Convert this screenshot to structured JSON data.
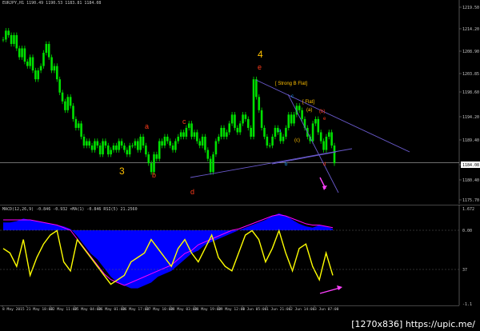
{
  "window": {
    "header": "EURJPY,H1  1190.49  1190.53  1183.81  1184.08",
    "macd_header": "MACD(12,26,9)  -0.846  -0.932   ×MA(1)  -0.846   RSI(5) 21.2560"
  },
  "watermark": "[1270x836] https://upic.me/",
  "colors": {
    "background": "#000000",
    "candle": "#00e000",
    "macd_fill": "#0000ff",
    "signal": "#ff00ff",
    "rsi": "#ffff00",
    "trendline": "#6a5acd",
    "grid": "#303030",
    "axis_text": "#c8c8c8",
    "wave_red": "#ff3b1a",
    "wave_orange": "#ffc000",
    "wave_blue": "#22a0ff"
  },
  "chart_data": [
    {
      "type": "line",
      "panel": "price",
      "yaxis_ticks": [
        "1219.50",
        "1214.20",
        "1208.90",
        "1203.85",
        "1198.60",
        "1194.20",
        "1189.40",
        "1184.08",
        "1180.40",
        "1175.70"
      ],
      "xaxis_ticks": [
        "8 May 2015",
        "21 May 18:00",
        "22 May 11:00",
        "25 May 04:00",
        "26 May 01:00",
        "26 May 17:00",
        "27 May 10:00",
        "28 May 03:00",
        "28 May 19:00",
        "29 May 12:00",
        "1 Jun 05:00",
        "1 Jun 21:00",
        "2 Jun 14:00",
        "3 Jun 07:00"
      ],
      "current_price": "1184.08",
      "series": [
        {
          "values": [
            1212,
            1214,
            1213,
            1211,
            1213,
            1210,
            1208,
            1210,
            1207,
            1206,
            1208,
            1205,
            1203,
            1205,
            1206,
            1209,
            1211,
            1208,
            1205,
            1206,
            1203,
            1200,
            1198,
            1196,
            1199,
            1197,
            1194,
            1192,
            1193,
            1190,
            1188,
            1189,
            1188,
            1187,
            1189,
            1188,
            1186,
            1189,
            1188,
            1186,
            1187,
            1188,
            1187,
            1189,
            1188,
            1187,
            1186,
            1188,
            1188,
            1189,
            1187,
            1190,
            1188,
            1186,
            1184,
            1182,
            1186,
            1185,
            1189,
            1188,
            1190,
            1189,
            1188,
            1187,
            1189,
            1190,
            1191,
            1190,
            1192,
            1193,
            1190,
            1191,
            1189,
            1188,
            1190,
            1187,
            1185,
            1182,
            1186,
            1189,
            1190,
            1192,
            1190,
            1191,
            1193,
            1195,
            1192,
            1191,
            1193,
            1195,
            1194,
            1192,
            1190,
            1203,
            1199,
            1196,
            1192,
            1190,
            1188,
            1188,
            1190,
            1192,
            1191,
            1189,
            1190,
            1192,
            1195,
            1193,
            1195,
            1197,
            1196,
            1194,
            1192,
            1190,
            1189,
            1193,
            1194,
            1191,
            1189,
            1187,
            1190,
            1191,
            1188,
            1184
          ]
        }
      ],
      "annotations": [
        {
          "text": "3",
          "color": "#ffc000"
        },
        {
          "text": "a",
          "color": "#ff3b1a"
        },
        {
          "text": "b",
          "color": "#ff3b1a"
        },
        {
          "text": "c",
          "color": "#ff3b1a"
        },
        {
          "text": "d",
          "color": "#ff3b1a"
        },
        {
          "text": "4",
          "color": "#ffc000"
        },
        {
          "text": "e",
          "color": "#ff3b1a"
        },
        {
          "text": "[ Strong B Flat]",
          "color": "#ffc000"
        },
        {
          "text": "[ Flat]",
          "color": "#ffc000"
        },
        {
          "text": "(a)",
          "color": "#ffc000"
        },
        {
          "text": "(b)",
          "color": "#ff3b1a"
        },
        {
          "text": "(c)",
          "color": "#ffc000"
        },
        {
          "text": "a",
          "color": "#22a0ff"
        },
        {
          "text": "b",
          "color": "#22a0ff"
        },
        {
          "text": "c",
          "color": "#22a0ff"
        },
        {
          "text": "d",
          "color": "#ff3b1a"
        },
        {
          "text": "e",
          "color": "#ff3b1a"
        }
      ]
    },
    {
      "type": "area",
      "panel": "macd",
      "yaxis_ticks": [
        "1.672",
        "0.00",
        "37",
        "-1.1"
      ],
      "series": [
        {
          "values": [
            0.6,
            0.6,
            0.7,
            0.9,
            0.8,
            0.7,
            0.6,
            0.5,
            0.4,
            0.3,
            0.1,
            -0.2,
            -0.5,
            -0.8,
            -1.0,
            -1.3,
            -1.6,
            -1.8,
            -1.9,
            -2.0,
            -2.0,
            -1.9,
            -1.8,
            -1.6,
            -1.5,
            -1.4,
            -1.2,
            -1.0,
            -0.8,
            -0.7,
            -0.5,
            -0.4,
            -0.3,
            -0.2,
            -0.1,
            0.0,
            0.2,
            0.4,
            0.6,
            0.8,
            1.1,
            1.3,
            1.1,
            0.8,
            0.5,
            0.3,
            0.2,
            0.4,
            0.3,
            0.1
          ]
        },
        {
          "values": [
            0.8,
            0.8,
            0.8,
            0.8,
            0.8,
            0.7,
            0.6,
            0.5,
            0.4,
            0.2,
            0.0,
            -0.3,
            -0.6,
            -0.9,
            -1.2,
            -1.5,
            -1.7,
            -1.8,
            -1.9,
            -1.8,
            -1.7,
            -1.6,
            -1.5,
            -1.4,
            -1.3,
            -1.2,
            -1.0,
            -0.8,
            -0.7,
            -0.5,
            -0.4,
            -0.3,
            -0.2,
            -0.1,
            0.0,
            0.1,
            0.3,
            0.5,
            0.7,
            0.9,
            1.1,
            1.2,
            1.1,
            0.9,
            0.7,
            0.5,
            0.4,
            0.4,
            0.3,
            0.2
          ]
        },
        {
          "values": [
            60,
            55,
            40,
            70,
            30,
            50,
            65,
            75,
            80,
            45,
            35,
            70,
            60,
            50,
            40,
            30,
            20,
            25,
            30,
            45,
            50,
            55,
            70,
            60,
            50,
            40,
            60,
            70,
            55,
            45,
            60,
            75,
            50,
            40,
            35,
            55,
            75,
            80,
            70,
            45,
            60,
            80,
            55,
            35,
            60,
            65,
            40,
            25,
            55,
            30
          ]
        }
      ]
    }
  ]
}
